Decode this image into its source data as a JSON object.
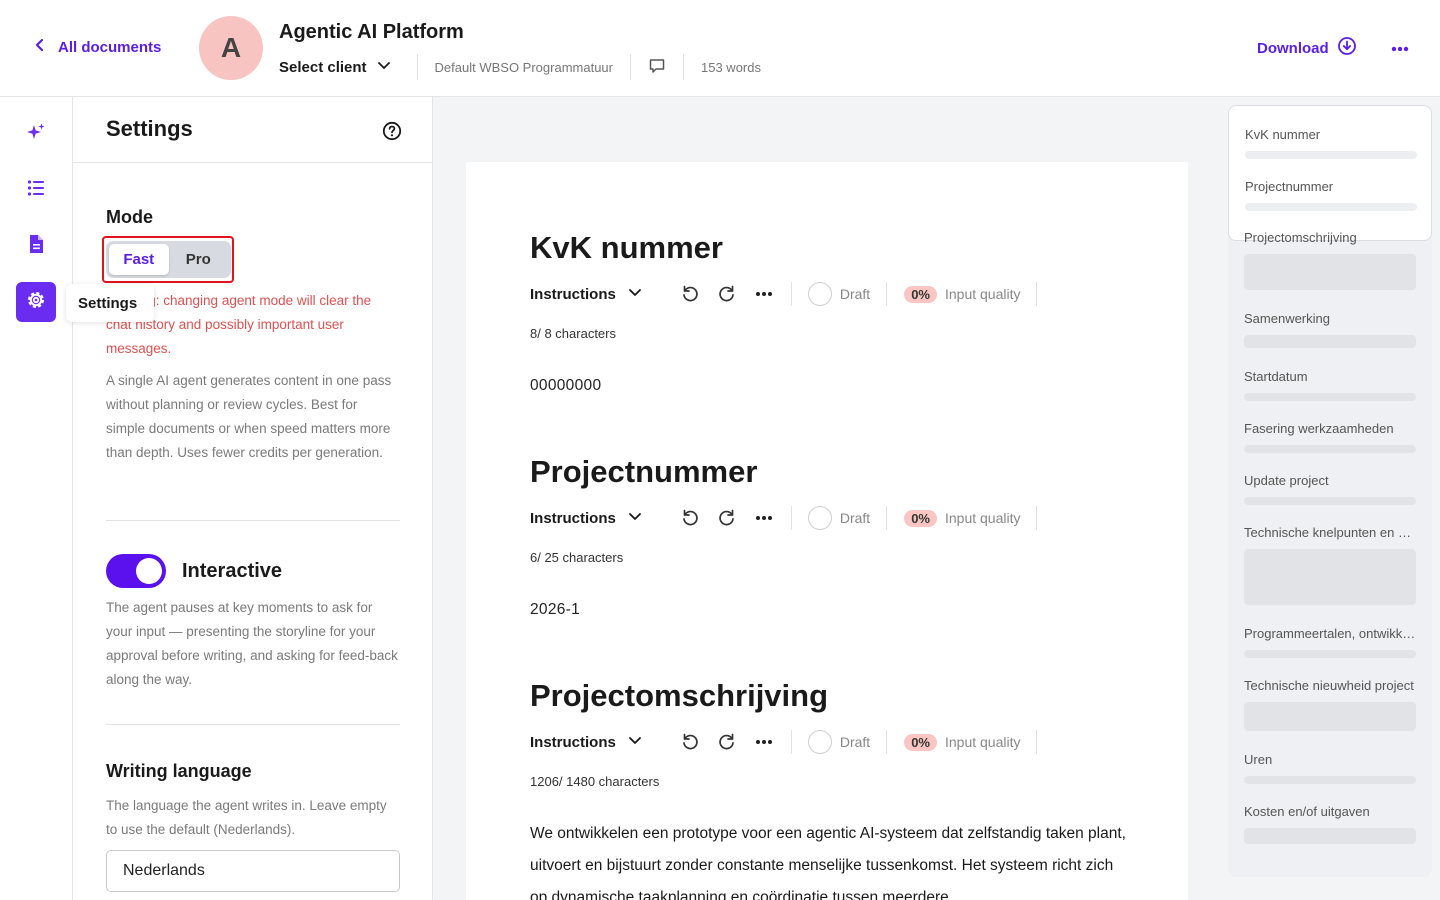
{
  "header": {
    "back_label": "All documents",
    "avatar_initial": "A",
    "title": "Agentic AI Platform",
    "select_client": "Select client",
    "template": "Default WBSO Programmatuur",
    "word_count": "153 words",
    "download_label": "Download"
  },
  "rail": {
    "tooltip": "Settings"
  },
  "settings": {
    "title": "Settings",
    "mode": {
      "title": "Mode",
      "options": [
        "Fast",
        "Pro"
      ],
      "selected": "Fast",
      "warning": "Warning: changing agent mode will clear the chat history and possibly important user messages.",
      "description": "A single AI agent generates content in one pass without planning or review cycles. Best for simple documents or when speed matters more than depth. Uses fewer credits per generation."
    },
    "interactive": {
      "label": "Interactive",
      "enabled": true,
      "description": "The agent pauses at key moments to ask for your input — presenting the storyline for your approval before writing, and asking for feed-back along the way."
    },
    "language": {
      "title": "Writing language",
      "description": "The language the agent writes in. Leave empty to use the default (Nederlands).",
      "value": "Nederlands"
    }
  },
  "toolbar": {
    "instructions": "Instructions",
    "draft": "Draft",
    "quality_pct": "0%",
    "quality_label": "Input quality"
  },
  "sections": [
    {
      "title": "KvK nummer",
      "chars": "8/ 8 characters",
      "value": "00000000"
    },
    {
      "title": "Projectnummer",
      "chars": "6/ 25 characters",
      "value": "2026-1"
    },
    {
      "title": "Projectomschrijving",
      "chars": "1206/ 1480 characters",
      "value": "We ontwikkelen een prototype voor een agentic AI-systeem dat zelfstandig taken plant, uitvoert en bijstuurt zonder constante menselijke tussenkomst. Het systeem richt zich op dynamische taakplanning en coördinatie tussen meerdere"
    }
  ],
  "outline": {
    "items": [
      "KvK nummer",
      "Projectnummer",
      "Projectomschrijving",
      "Samenwerking",
      "Startdatum",
      "Fasering werkzaamheden",
      "Update project",
      "Technische knelpunten en oplossingsrichtingen",
      "Programmeertalen, ontwikkelomgevingen en tools",
      "Technische nieuwheid project",
      "Uren",
      "Kosten en/of uitgaven"
    ]
  },
  "colors": {
    "accent": "#5b1ee6",
    "warning": "#e05050",
    "badge": "#f9c6c4"
  }
}
